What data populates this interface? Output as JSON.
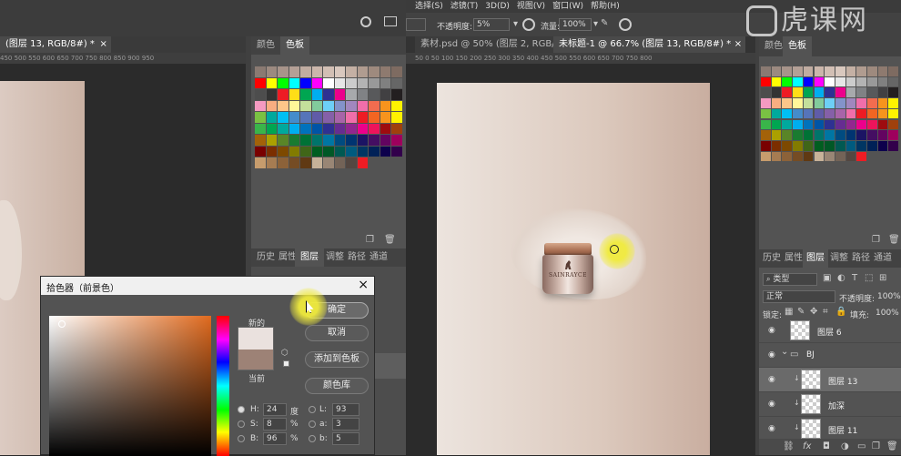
{
  "menu": {
    "items": [
      "选择(S)",
      "滤镜(T)",
      "3D(D)",
      "视图(V)",
      "窗口(W)",
      "帮助(H)"
    ]
  },
  "options": {
    "opacity_label": "不透明度:",
    "opacity_value": "5%",
    "flow_label": "流量:",
    "flow_value": "100%"
  },
  "left_doc": {
    "tab": "(图层 13, RGB/8#) *",
    "ruler": "450  500  550  600  650  700  750  800  850  900  950"
  },
  "left_panel": {
    "tabs": [
      "颜色",
      "色板"
    ],
    "layer_tabs": [
      "历史",
      "属性",
      "图层",
      "调整",
      "路径",
      "通道"
    ]
  },
  "right_doc": {
    "tabs": [
      "素材.psd @ 50% (图层 2, RGB/8#)",
      "未标题-1 @ 66.7% (图层 13, RGB/8#) *"
    ],
    "ruler": "50    0    50   100  150  200  250  300  350  400  450  500  550  600  650  700  750  800"
  },
  "product": {
    "brand": "SAINRAYCE"
  },
  "watermark": {
    "text": "虎课网"
  },
  "color_picker": {
    "title": "拾色器（前景色）",
    "new_label": "新的",
    "current_label": "当前",
    "ok": "确定",
    "cancel": "取消",
    "add_swatch": "添加到色板",
    "color_library": "颜色库",
    "h_label": "H:",
    "h_value": "24",
    "h_unit": "度",
    "s_label": "S:",
    "s_value": "8",
    "s_unit": "%",
    "b_label": "B:",
    "b_value": "96",
    "b_unit": "%",
    "l_label": "L:",
    "l_value": "93",
    "a_label": "a:",
    "a_value": "3",
    "bb_label": "b:",
    "bb_value": "5",
    "new_color": "#eae1de",
    "current_color": "#9d8276"
  },
  "right_panel": {
    "tabs": [
      "颜色",
      "色板"
    ],
    "layer_tabs": [
      "历史",
      "属性",
      "图层",
      "调整",
      "路径",
      "通道"
    ],
    "filter_label": "类型",
    "blend_mode": "正常",
    "opacity_label": "不透明度:",
    "opacity_value": "100%",
    "lock_label": "锁定:",
    "fill_label": "填充:",
    "fill_value": "100%",
    "layers": [
      {
        "name": "图层 6",
        "kind": "layer",
        "selected": false
      },
      {
        "name": "BJ",
        "kind": "group",
        "selected": false
      },
      {
        "name": "图层 13",
        "kind": "layer",
        "selected": true
      },
      {
        "name": "加深",
        "kind": "layer",
        "selected": false
      },
      {
        "name": "图层 11",
        "kind": "layer",
        "selected": false
      }
    ]
  },
  "swatch_colors": {
    "row1": [
      "#8a7a72",
      "#9c8a80",
      "#a7948a",
      "#b4a096",
      "#c0aca1",
      "#cbb6ab",
      "#d2bfb4",
      "#d9c8be",
      "#c4b0a4",
      "#b09c90",
      "#9e8a7e",
      "#8e7a6f",
      "#7e6b61"
    ],
    "row2": [
      "#ff0000",
      "#ffff00",
      "#00ff00",
      "#00ffff",
      "#0000ff",
      "#ff00ff",
      "#ffffff",
      "#e6e6e6",
      "#cccccc",
      "#b3b3b3",
      "#999999",
      "#808080",
      "#666666"
    ],
    "row3": [
      "#4d4d4d",
      "#333333",
      "#ed1c24",
      "#ffde17",
      "#00a651",
      "#00aeef",
      "#2e3192",
      "#ec008c",
      "#a7a9ac",
      "#808285",
      "#58595b",
      "#414042",
      "#231f20"
    ],
    "row4": [
      "#f49ac1",
      "#f9ad81",
      "#fdc689",
      "#fff799",
      "#c4df9b",
      "#82ca9c",
      "#6dcff6",
      "#8393ca",
      "#a187be",
      "#f06eaa",
      "#f26c4f",
      "#f7941d",
      "#fff200"
    ],
    "row5": [
      "#7ac143",
      "#00a99d",
      "#00bff3",
      "#448ccb",
      "#5674b9",
      "#605ca8",
      "#8560a8",
      "#a864a8",
      "#f06ea9",
      "#ed1c24",
      "#f26522",
      "#f7941d",
      "#fff200"
    ],
    "row6": [
      "#39b54a",
      "#00a651",
      "#00a99d",
      "#00aeef",
      "#0072bc",
      "#0054a6",
      "#2e3192",
      "#662d91",
      "#92278f",
      "#ec008c",
      "#ed145b",
      "#9e0b0f",
      "#a0410d"
    ],
    "row7": [
      "#a36209",
      "#aba000",
      "#598527",
      "#1a7b30",
      "#007236",
      "#00746b",
      "#0076a3",
      "#004b80",
      "#003471",
      "#1b1464",
      "#440e62",
      "#630460",
      "#9e005d"
    ],
    "row8": [
      "#790000",
      "#7b2e00",
      "#7d4900",
      "#827b00",
      "#406618",
      "#005e20",
      "#005826",
      "#005952",
      "#005b7f",
      "#003663",
      "#002157",
      "#0d004c",
      "#32004b"
    ],
    "row9": [
      "#c69c6d",
      "#a67c52",
      "#8c6239",
      "#754c24",
      "#603913",
      "#c7b299",
      "#998675",
      "#736357",
      "#534741",
      "#ed1c24"
    ]
  }
}
